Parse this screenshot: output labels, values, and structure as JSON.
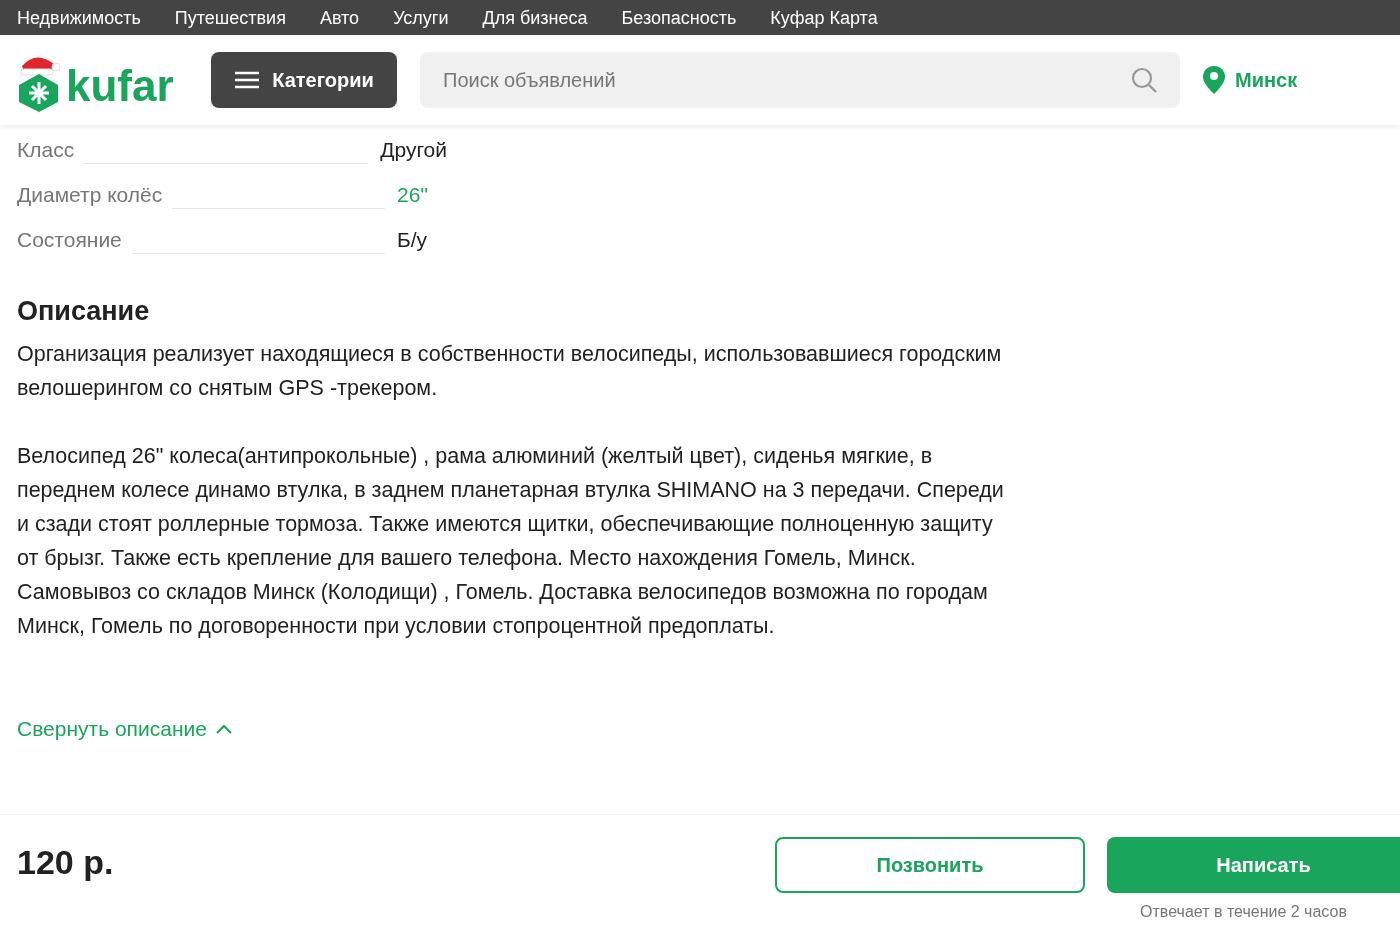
{
  "top_nav": [
    "Недвижимость",
    "Путешествия",
    "Авто",
    "Услуги",
    "Для бизнеса",
    "Безопасность",
    "Куфар Карта"
  ],
  "header": {
    "logo": "kufar",
    "categories_button": "Категории",
    "search": {
      "placeholder": "Поиск объявлений"
    },
    "city": "Минск"
  },
  "params": [
    {
      "label": "Класс",
      "value": "Другой",
      "kind": "text"
    },
    {
      "label": "Диаметр колёс",
      "value": "26''",
      "kind": "link"
    },
    {
      "label": "Состояние",
      "value": "Б/у",
      "kind": "text"
    }
  ],
  "description": {
    "title": "Описание",
    "paragraphs": [
      [
        "Организация реализует находящиеся в собственности велосипеды, использовавшиеся городским велошерингом со снятым GPS -трекером."
      ],
      [
        "Велосипед 26\" колеса(антипрокольные) , рама алюминий (желтый цвет), сиденья мягкие, в переднем колесе динамо втулка, в заднем планетарная втулка SHIMANO на 3 передачи. Спереди и сзади стоят роллерные тормоза. Также имеются щитки, обеспечивающие полноценную защиту от брызг. Также есть крепление для вашего телефона. Место нахождения Гомель, Минск.",
        "Самовывоз со складов Минск (Колодищи) , Гомель. Доставка велосипедов возможна по городам Минск, Гомель по договоренности при условии стопроцентной предоплаты."
      ]
    ],
    "collapse_link": "Свернуть описание"
  },
  "footer": {
    "price": "120 р.",
    "call_button": "Позвонить",
    "write_button": "Написать",
    "response_note": "Отвечает в течение 2 часов"
  }
}
